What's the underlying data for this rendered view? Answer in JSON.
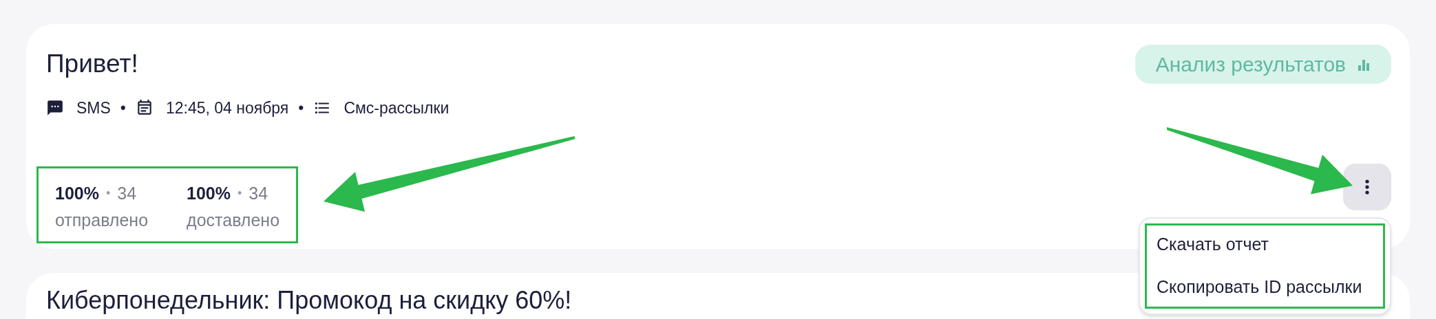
{
  "cards": [
    {
      "title": "Привет!",
      "meta": [
        {
          "kind": "sms",
          "text": "SMS"
        },
        {
          "kind": "date",
          "text": "12:45, 04 ноября"
        },
        {
          "kind": "list",
          "text": "Смс-рассылки"
        }
      ],
      "meta_separator": "•",
      "analysis_button": "Анализ результатов",
      "stats": [
        {
          "percent": "100%",
          "separator": "•",
          "count": "34",
          "label": "отправлено"
        },
        {
          "percent": "100%",
          "separator": "•",
          "count": "34",
          "label": "доставлено"
        }
      ],
      "menu": {
        "items": [
          "Скачать отчет",
          "Скопировать ID рассылки"
        ]
      }
    },
    {
      "title": "Киберпонедельник: Промокод на скидку 60%!"
    }
  ]
}
